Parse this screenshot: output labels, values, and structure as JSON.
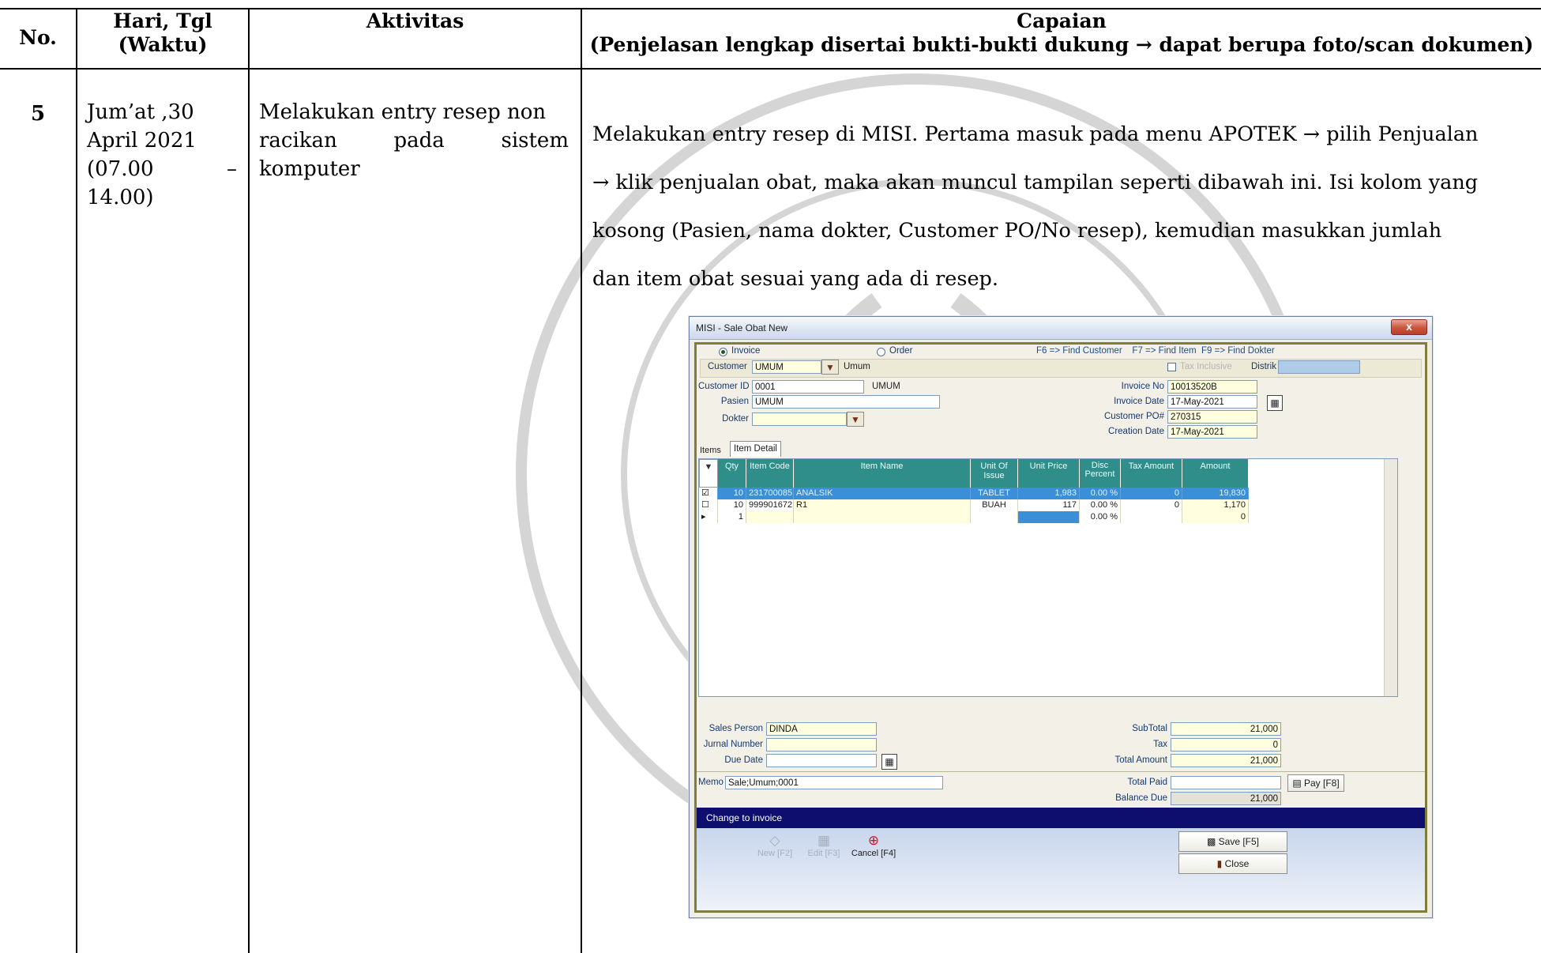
{
  "table": {
    "headers": {
      "no": "No.",
      "date_line1": "Hari, Tgl",
      "date_line2": "(Waktu)",
      "activity": "Aktivitas",
      "result_line1": "Capaian",
      "result_line2": "(Penjelasan lengkap disertai bukti-bukti dukung → dapat berupa foto/scan dokumen)"
    },
    "row": {
      "no": "5",
      "date_lines": [
        "Jum’at ,30",
        "April 2021",
        "(07.00",
        "–",
        "14.00)"
      ],
      "activity_lines": [
        "Melakukan entry resep non",
        "racikan",
        "pada",
        "sistem",
        "komputer"
      ],
      "result_lines": [
        "Melakukan entry resep di MISI.  Pertama masuk pada menu APOTEK → pilih Penjualan",
        "→ klik penjualan obat, maka akan muncul tampilan seperti dibawah ini. Isi kolom yang",
        "kosong (Pasien, nama dokter, Customer PO/No resep), kemudian masukkan jumlah",
        "dan item obat sesuai yang ada di resep."
      ]
    }
  },
  "screenshot": {
    "title": "MISI - Sale Obat New",
    "close_label": "x",
    "radio_invoice": "Invoice",
    "radio_order": "Order",
    "hotkeys": "F6 => Find Customer    F7 => Find Item  F9 => Find Dokter",
    "customer_label": "Customer",
    "customer_value": "UMUM",
    "customer_name": "Umum",
    "tax_inclusive": "Tax Inclusive",
    "distrik_label": "Distrik",
    "customer_id_label": "Customer ID",
    "customer_id_value": "0001",
    "customer_id_name": "UMUM",
    "pasien_label": "Pasien",
    "pasien_value": "UMUM",
    "dokter_label": "Dokter",
    "dokter_value": "",
    "invoice_no_label": "Invoice No",
    "invoice_no_value": "10013520B",
    "invoice_date_label": "Invoice Date",
    "invoice_date_value": "17-May-2021",
    "customer_po_label": "Customer PO#",
    "customer_po_value": "270315",
    "creation_date_label": "Creation Date",
    "creation_date_value": "17-May-2021",
    "tabs": [
      "Items",
      "Item Detail"
    ],
    "columns": {
      "qty": "Qty",
      "code": "Item Code",
      "name": "Item Name",
      "unit": "Unit Of Issue",
      "price": "Unit Price",
      "disc_1": "Disc",
      "disc_2": "Percent",
      "tax": "Tax Amount",
      "amount": "Amount"
    },
    "rows": [
      {
        "qty": "10",
        "code": "231700085",
        "name": "ANALSIK",
        "unit": "TABLET",
        "price": "1,983",
        "disc": "0.00 %",
        "tax": "0",
        "amount": "19,830"
      },
      {
        "qty": "10",
        "code": "999901672",
        "name": "R1",
        "unit": "BUAH",
        "price": "117",
        "disc": "0.00 %",
        "tax": "0",
        "amount": "1,170"
      },
      {
        "qty": "1",
        "code": "",
        "name": "",
        "unit": "",
        "price": "",
        "disc": "0.00 %",
        "tax": "",
        "amount": "0"
      }
    ],
    "sales_person_label": "Sales Person",
    "sales_person_value": "DINDA",
    "jurnal_label": "Jurnal Number",
    "jurnal_value": "",
    "due_date_label": "Due Date",
    "due_date_value": "",
    "subtotal_label": "SubTotal",
    "subtotal_value": "21,000",
    "tax_label": "Tax",
    "tax_value": "0",
    "total_amount_label": "Total Amount",
    "total_amount_value": "21,000",
    "memo_label": "Memo",
    "memo_value": "Sale;Umum;0001",
    "total_paid_label": "Total Paid",
    "total_paid_value": "",
    "balance_due_label": "Balance Due",
    "balance_due_value": "21,000",
    "pay_label": "Pay [F8]",
    "status_text": "Change to invoice",
    "new_label": "New [F2]",
    "edit_label": "Edit [F3]",
    "cancel_label": "Cancel [F4]",
    "save_label": "Save [F5]",
    "close_btn_label": "Close"
  }
}
